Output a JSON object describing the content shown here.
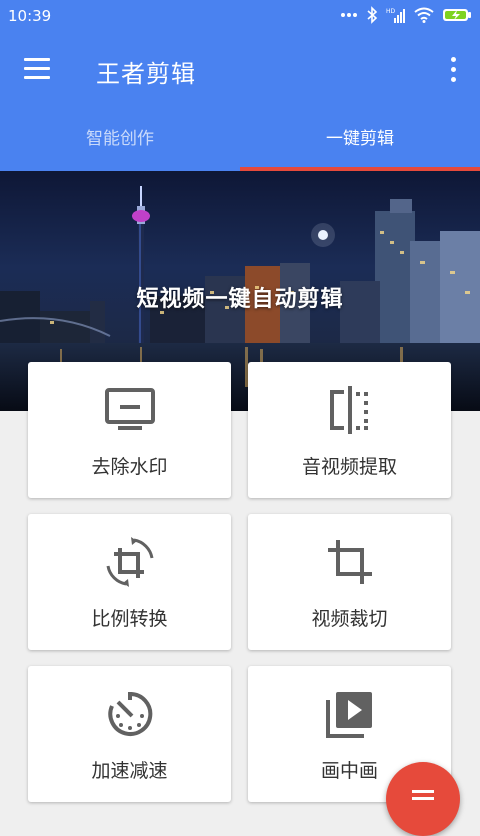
{
  "status_bar": {
    "time": "10:39"
  },
  "app_bar": {
    "title": "王者剪辑",
    "menu_icon": "hamburger-menu-icon",
    "more_icon": "more-vert-icon"
  },
  "tabs": [
    {
      "label": "智能创作",
      "active": false
    },
    {
      "label": "一键剪辑",
      "active": true
    }
  ],
  "banner": {
    "title": "短视频一键自动剪辑"
  },
  "tools": [
    {
      "label": "去除水印",
      "icon": "monitor-icon"
    },
    {
      "label": "音视频提取",
      "icon": "split-compare-icon"
    },
    {
      "label": "比例转换",
      "icon": "crop-rotate-icon"
    },
    {
      "label": "视频裁切",
      "icon": "crop-icon"
    },
    {
      "label": "加速减速",
      "icon": "speed-timer-icon"
    },
    {
      "label": "画中画",
      "icon": "video-library-icon"
    }
  ],
  "fab": {
    "icon": "menu-icon"
  },
  "colors": {
    "primary": "#4a82f0",
    "accent": "#e64a3b",
    "icon": "#616161"
  }
}
